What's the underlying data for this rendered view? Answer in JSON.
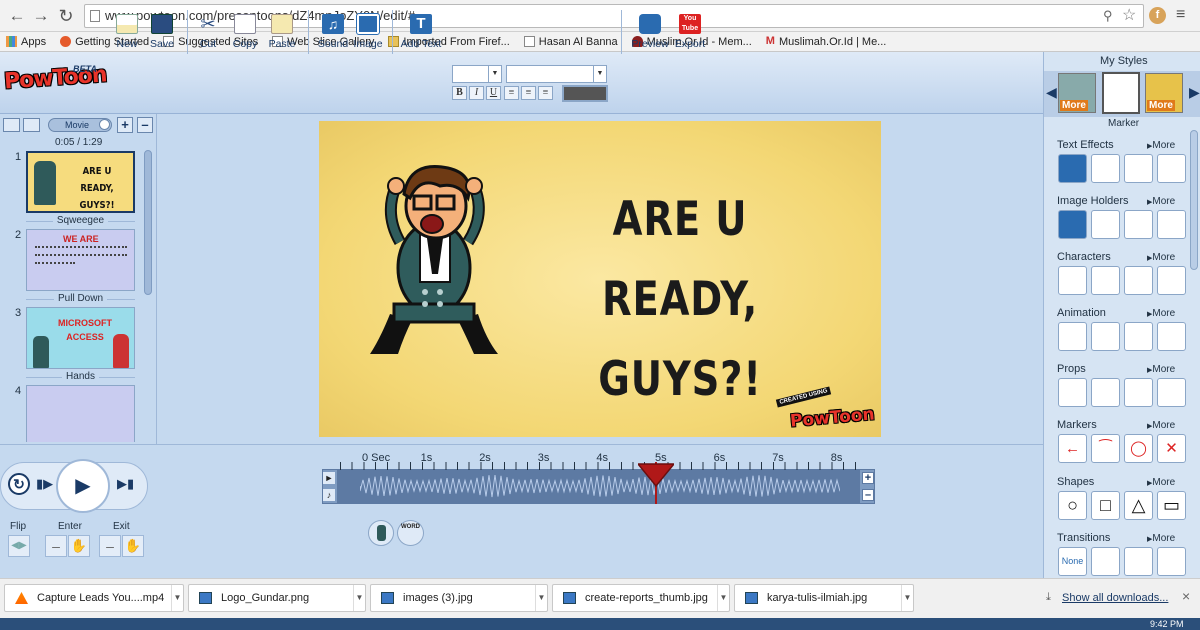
{
  "browser": {
    "url": "www.powtoon.com/presentoons/dZ4mnJoZY0N/edit/#",
    "bookmarks": [
      "Apps",
      "Getting Started",
      "Suggested Sites",
      "Web Slice Gallery",
      "Imported From Firef...",
      "Hasan Al Banna",
      "Muslim.Or.Id - Mem...",
      "Muslimah.Or.Id | Me..."
    ]
  },
  "app": {
    "logo": "PowToon",
    "beta": "BETA",
    "toolbar": {
      "new": "New",
      "save": "Save",
      "cut": "Cut",
      "copy": "Copy",
      "paste": "Paste",
      "sound": "Sound",
      "image": "Image",
      "add_text": "Add Text",
      "preview": "Preview",
      "export": "Export",
      "bold": "B",
      "italic": "I",
      "underline": "U"
    }
  },
  "left_panel": {
    "mode": "Movie",
    "time": "0:05 / 1:29",
    "slides": [
      {
        "num": "1",
        "title": "ARE U READY, GUYS?!"
      },
      {
        "num": "2",
        "title": "WE ARE"
      },
      {
        "num": "3",
        "title": "MICROSOFT ACCESS"
      },
      {
        "num": "4",
        "title": ""
      }
    ],
    "transitions": [
      "Sqweegee",
      "Pull Down",
      "Hands"
    ]
  },
  "stage": {
    "headline_line1": "ARE U READY,",
    "headline_line2": "GUYS?!",
    "badge_top": "CREATED USING",
    "badge_brand": "PowToon"
  },
  "right_panel": {
    "my_styles": "My Styles",
    "style_selected": "Marker",
    "more": "More",
    "sections": [
      "Text Effects",
      "Image Holders",
      "Characters",
      "Animation",
      "Props",
      "Markers",
      "Shapes",
      "Transitions"
    ],
    "more_link": "More",
    "transition_none": "None"
  },
  "timeline": {
    "ticks": [
      "0 Sec",
      "1s",
      "2s",
      "3s",
      "4s",
      "5s",
      "6s",
      "7s",
      "8s"
    ],
    "flip": "Flip",
    "enter": "Enter",
    "exit": "Exit",
    "word_chip": "WORD"
  },
  "downloads": {
    "items": [
      "Capture Leads  You....mp4",
      "Logo_Gundar.png",
      "images (3).jpg",
      "create-reports_thumb.jpg",
      "karya-tulis-ilmiah.jpg"
    ],
    "show_all": "Show all downloads...",
    "clock": "9:42 PM"
  },
  "colors": {
    "accent": "#1a3a66",
    "stage_bg": "#f3d774",
    "panel": "#c5d9ef",
    "playhead": "#b01818"
  }
}
